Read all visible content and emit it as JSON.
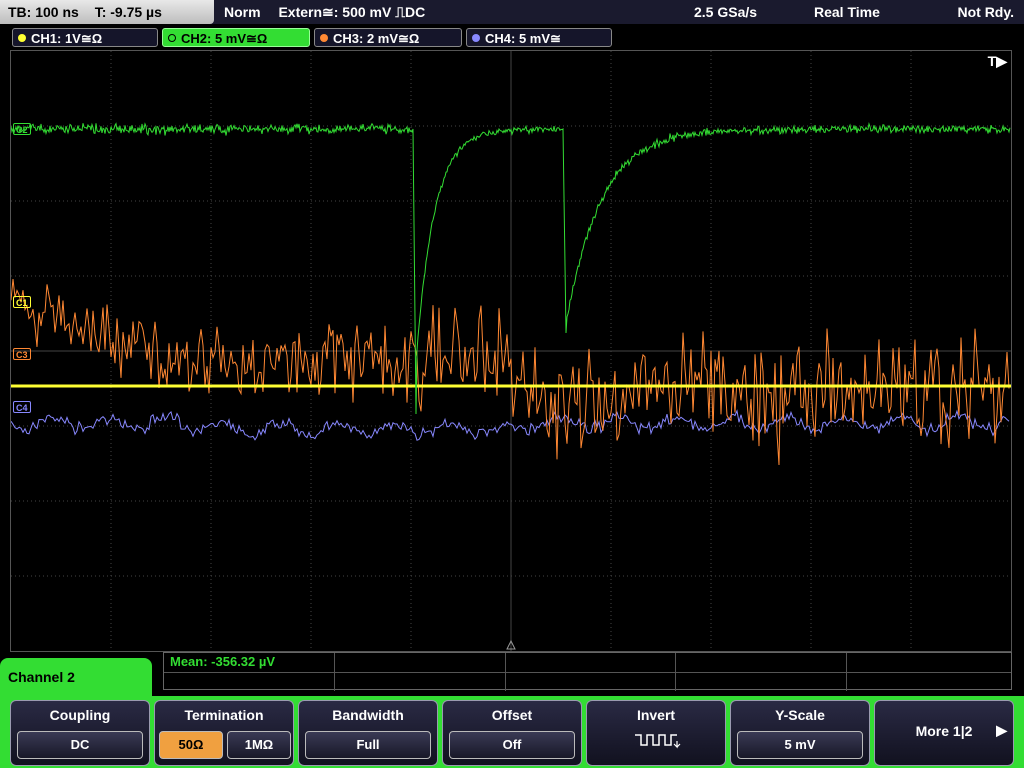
{
  "header": {
    "timebase": "TB: 100 ns",
    "trigger_time": "T: -9.75 µs",
    "trigger_mode": "Norm",
    "trigger_source": "Extern≅: 500 mV ⎍DC",
    "sample_rate": "2.5 GSa/s",
    "acq_mode": "Real Time",
    "status": "Not Rdy."
  },
  "channels": [
    {
      "label": "CH1: 1V≅Ω",
      "color": "#ffff33"
    },
    {
      "label": "CH2: 5 mV≅Ω",
      "color": "#33dd33",
      "active": true
    },
    {
      "label": "CH3: 2 mV≅Ω",
      "color": "#ff8833"
    },
    {
      "label": "CH4: 5 mV≅",
      "color": "#8888ff"
    }
  ],
  "markers": {
    "c2": "C2",
    "c1": "C1",
    "c3": "C3",
    "c4": "C4"
  },
  "trigger_indicator": "T▶",
  "measurement": {
    "mean": "Mean: -356.32 µV"
  },
  "menu": {
    "title": "Channel 2",
    "coupling": {
      "label": "Coupling",
      "value": "DC"
    },
    "termination": {
      "label": "Termination",
      "opt1": "50Ω",
      "opt2": "1MΩ"
    },
    "bandwidth": {
      "label": "Bandwidth",
      "value": "Full"
    },
    "offset": {
      "label": "Offset",
      "value": "Off"
    },
    "invert": {
      "label": "Invert"
    },
    "yscale": {
      "label": "Y-Scale",
      "value": "5 mV"
    },
    "more": {
      "label": "More 1|2",
      "arrow": "▶"
    }
  },
  "colors": {
    "ch1": "#ffff33",
    "ch2": "#33dd33",
    "ch3": "#ff8833",
    "ch4": "#8888ff",
    "grid": "#444444",
    "menu": "#33dd33"
  }
}
